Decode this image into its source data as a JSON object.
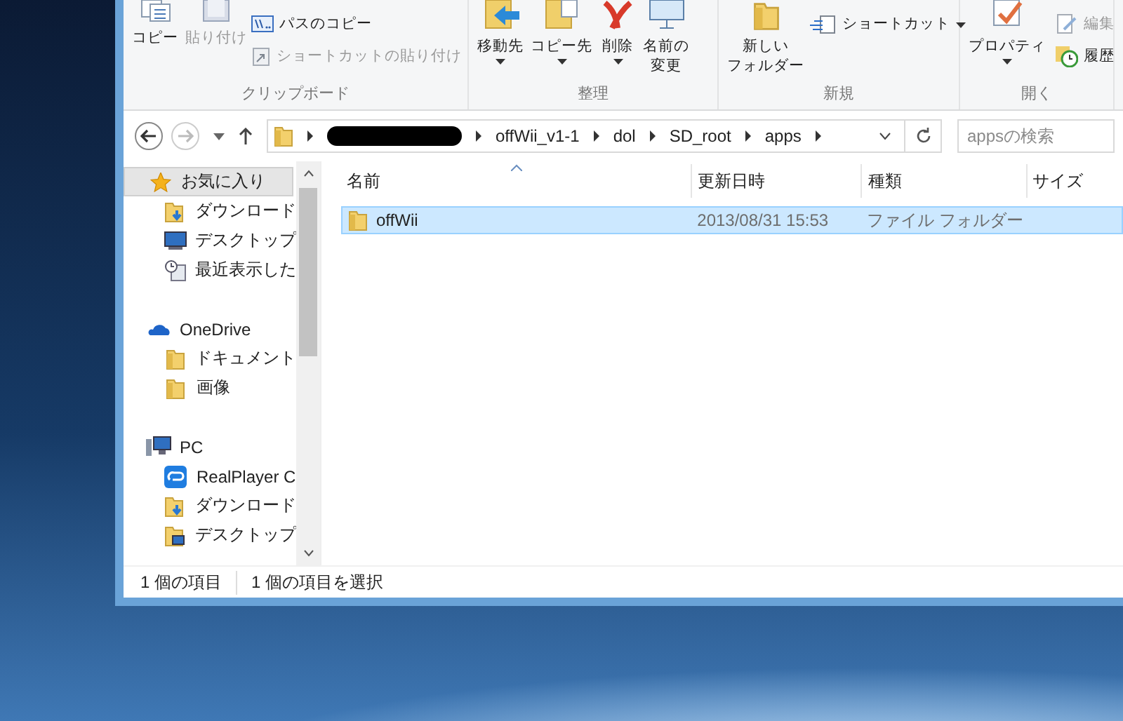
{
  "ribbon": {
    "groups": [
      {
        "label": "クリップボード",
        "large_buttons": [
          {
            "kind": "copy",
            "lines": [
              "コピー"
            ],
            "disabled": false,
            "dropdown": false
          },
          {
            "kind": "paste",
            "lines": [
              "貼り付け"
            ],
            "disabled": true,
            "dropdown": false
          }
        ],
        "small_buttons": [
          {
            "kind": "path",
            "label": "パスのコピー",
            "disabled": false,
            "dropdown": false
          },
          {
            "kind": "shortcut-paste",
            "label": "ショートカットの貼り付け",
            "disabled": true,
            "dropdown": false
          }
        ]
      },
      {
        "label": "整理",
        "large_buttons": [
          {
            "kind": "move",
            "lines": [
              "移動先"
            ],
            "disabled": false,
            "dropdown": true
          },
          {
            "kind": "copyto",
            "lines": [
              "コピー先"
            ],
            "disabled": false,
            "dropdown": true
          },
          {
            "kind": "delete",
            "lines": [
              "削除"
            ],
            "disabled": false,
            "dropdown": true
          },
          {
            "kind": "rename",
            "lines": [
              "名前の",
              "変更"
            ],
            "disabled": false,
            "dropdown": false
          }
        ]
      },
      {
        "label": "新規",
        "large_buttons": [
          {
            "kind": "newfolder",
            "lines": [
              "新しい",
              "フォルダー"
            ],
            "disabled": false,
            "dropdown": false
          }
        ],
        "small_buttons": [
          {
            "kind": "shortcut",
            "label": "ショートカット",
            "disabled": false,
            "dropdown": true
          }
        ]
      },
      {
        "label": "開く",
        "large_buttons": [
          {
            "kind": "properties",
            "lines": [
              "プロパティ"
            ],
            "disabled": false,
            "dropdown": true
          }
        ],
        "small_buttons": [
          {
            "kind": "edit",
            "label": "編集",
            "disabled": true,
            "dropdown": false
          },
          {
            "kind": "history",
            "label": "履歴",
            "disabled": false,
            "dropdown": false
          }
        ]
      }
    ]
  },
  "address": {
    "segments": [
      {
        "kind": "redacted"
      },
      {
        "kind": "text",
        "label": "offWii_v1-1"
      },
      {
        "kind": "text",
        "label": "dol"
      },
      {
        "kind": "text",
        "label": "SD_root"
      },
      {
        "kind": "text",
        "label": "apps"
      }
    ],
    "search_placeholder": "appsの検索"
  },
  "nav": [
    {
      "label": "お気に入り",
      "selected": true,
      "children": [
        {
          "label": "ダウンロード",
          "selected": false
        },
        {
          "label": "デスクトップ",
          "selected": false
        },
        {
          "label": "最近表示した",
          "selected": false
        }
      ]
    },
    {
      "label": "OneDrive",
      "selected": false,
      "children": [
        {
          "label": "ドキュメント",
          "selected": false
        },
        {
          "label": "画像",
          "selected": false
        }
      ]
    },
    {
      "label": "PC",
      "selected": false,
      "children": [
        {
          "label": "RealPlayer C",
          "selected": false
        },
        {
          "label": "ダウンロード",
          "selected": false
        },
        {
          "label": "デスクトップ",
          "selected": false
        }
      ]
    }
  ],
  "table": {
    "columns": [
      "名前",
      "更新日時",
      "種類",
      "サイズ"
    ],
    "rows": [
      {
        "name": "offWii",
        "modified": "2013/08/31 15:53",
        "type": "ファイル フォルダー",
        "selected": true
      }
    ]
  },
  "status_bar": [
    "1 個の項目",
    "1 個の項目を選択"
  ]
}
